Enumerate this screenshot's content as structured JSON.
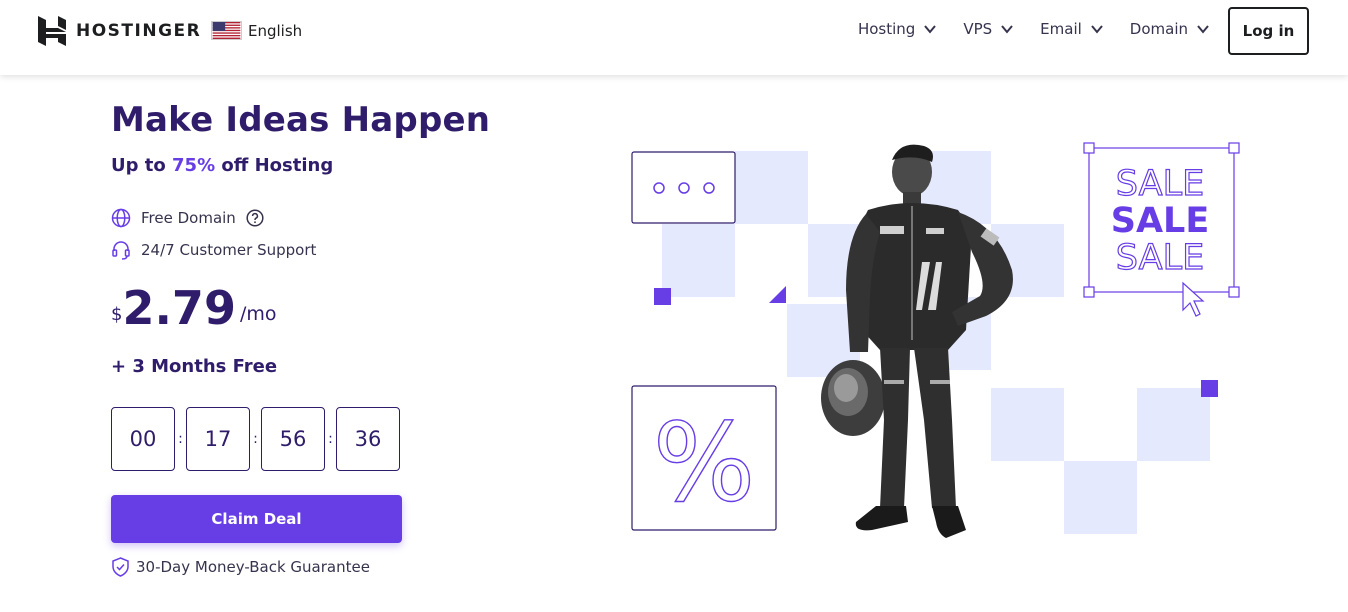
{
  "brand": {
    "name": "HOSTINGER"
  },
  "language": {
    "label": "English",
    "flag": "us-flag-icon"
  },
  "nav": {
    "items": [
      {
        "label": "Hosting"
      },
      {
        "label": "VPS"
      },
      {
        "label": "Email"
      },
      {
        "label": "Domain"
      }
    ],
    "login_label": "Log in"
  },
  "hero": {
    "title": "Make Ideas Happen",
    "subtitle_prefix": "Up to ",
    "subtitle_percent": "75%",
    "subtitle_suffix": " off Hosting",
    "features": [
      {
        "label": "Free Domain",
        "icon": "globe-icon"
      },
      {
        "label": "24/7 Customer Support",
        "icon": "headset-icon"
      }
    ],
    "price": {
      "currency": "$",
      "amount": "2.79",
      "period": "/mo"
    },
    "bonus": "+ 3 Months Free",
    "timer": [
      "00",
      "17",
      "56",
      "36"
    ],
    "timer_separator": ":",
    "cta_label": "Claim Deal",
    "guarantee": "30-Day Money-Back Guarantee"
  },
  "illustration": {
    "sale_lines": [
      "SALE",
      "SALE",
      "SALE"
    ],
    "percent_symbol": "%",
    "dots": "○ ○ ○"
  },
  "colors": {
    "brand_purple": "#673de6",
    "dark_navy": "#2f1c6a",
    "light_lavender": "#e5e9fd"
  }
}
